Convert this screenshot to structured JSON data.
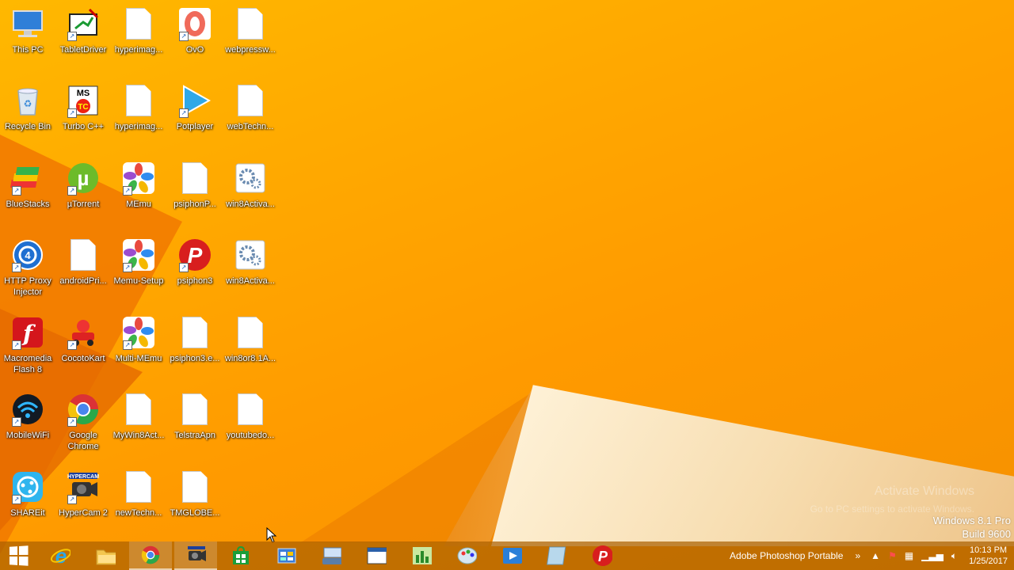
{
  "desktop_icons": [
    {
      "label": "This PC",
      "icon": "computer-icon",
      "col": 0,
      "row": 0
    },
    {
      "label": "Recycle Bin",
      "icon": "recycle-bin-icon",
      "col": 0,
      "row": 1
    },
    {
      "label": "BlueStacks",
      "icon": "bluestacks-icon",
      "col": 0,
      "row": 2
    },
    {
      "label": "HTTP Proxy Injector",
      "icon": "proxy-injector-icon",
      "col": 0,
      "row": 3
    },
    {
      "label": "Macromedia Flash 8",
      "icon": "flash-icon",
      "col": 0,
      "row": 4
    },
    {
      "label": "MobileWiFi",
      "icon": "wifi-icon",
      "col": 0,
      "row": 5
    },
    {
      "label": "SHAREit",
      "icon": "shareit-icon",
      "col": 0,
      "row": 6
    },
    {
      "label": "TabletDriver",
      "icon": "tablet-driver-icon",
      "col": 1,
      "row": 0
    },
    {
      "label": "Turbo C++",
      "icon": "turbo-cpp-icon",
      "col": 1,
      "row": 1
    },
    {
      "label": "µTorrent",
      "icon": "utorrent-icon",
      "col": 1,
      "row": 2
    },
    {
      "label": "androidPri...",
      "icon": "document-icon",
      "col": 1,
      "row": 3
    },
    {
      "label": "CocotoKart",
      "icon": "kart-icon",
      "col": 1,
      "row": 4
    },
    {
      "label": "Google Chrome",
      "icon": "chrome-icon",
      "col": 1,
      "row": 5
    },
    {
      "label": "HyperCam 2",
      "icon": "hypercam-icon",
      "col": 1,
      "row": 6
    },
    {
      "label": "hyperimag...",
      "icon": "document-icon",
      "col": 2,
      "row": 0
    },
    {
      "label": "hyperimag...",
      "icon": "document-icon",
      "col": 2,
      "row": 1
    },
    {
      "label": "MEmu",
      "icon": "memu-icon",
      "col": 2,
      "row": 2
    },
    {
      "label": "Memu-Setup",
      "icon": "memu-icon",
      "col": 2,
      "row": 3
    },
    {
      "label": "Multi-MEmu",
      "icon": "memu-icon",
      "col": 2,
      "row": 4
    },
    {
      "label": "MyWin8Act...",
      "icon": "document-icon",
      "col": 2,
      "row": 5
    },
    {
      "label": "newTechn...",
      "icon": "document-icon",
      "col": 2,
      "row": 6
    },
    {
      "label": "OvO",
      "icon": "ovo-icon",
      "col": 3,
      "row": 0
    },
    {
      "label": "Potplayer",
      "icon": "potplayer-icon",
      "col": 3,
      "row": 1
    },
    {
      "label": "psiphonP...",
      "icon": "document-icon",
      "col": 3,
      "row": 2
    },
    {
      "label": "psiphon3",
      "icon": "psiphon-icon",
      "col": 3,
      "row": 3
    },
    {
      "label": "psiphon3.e...",
      "icon": "document-icon",
      "col": 3,
      "row": 4
    },
    {
      "label": "TelstraApn",
      "icon": "document-icon",
      "col": 3,
      "row": 5
    },
    {
      "label": "TMGLOBE...",
      "icon": "document-icon",
      "col": 3,
      "row": 6
    },
    {
      "label": "webpressw...",
      "icon": "document-icon",
      "col": 4,
      "row": 0
    },
    {
      "label": "webTechn...",
      "icon": "document-icon",
      "col": 4,
      "row": 1
    },
    {
      "label": "win8Activa...",
      "icon": "settings-file-icon",
      "col": 4,
      "row": 2
    },
    {
      "label": "win8Activa...",
      "icon": "settings-file-icon",
      "col": 4,
      "row": 3
    },
    {
      "label": "win8or8.1A...",
      "icon": "document-icon",
      "col": 4,
      "row": 4
    },
    {
      "label": "youtubedo...",
      "icon": "document-icon",
      "col": 4,
      "row": 5
    }
  ],
  "watermark": {
    "title": "Activate Windows",
    "subtitle": "Go to PC settings to activate Windows."
  },
  "build_info": {
    "line1": "Windows 8.1 Pro",
    "line2": "Build 9600"
  },
  "taskbar": {
    "buttons": [
      {
        "name": "start-button",
        "icon": "windows-logo-icon"
      },
      {
        "name": "taskbar-internet-explorer",
        "icon": "internet-explorer-icon"
      },
      {
        "name": "taskbar-file-explorer",
        "icon": "folder-icon"
      },
      {
        "name": "taskbar-chrome",
        "icon": "chrome-icon"
      },
      {
        "name": "taskbar-hypercam",
        "icon": "hypercam-icon"
      },
      {
        "name": "taskbar-store",
        "icon": "store-icon"
      },
      {
        "name": "taskbar-control-panel",
        "icon": "control-panel-icon"
      },
      {
        "name": "taskbar-keyboard-app",
        "icon": "keyboard-icon"
      },
      {
        "name": "taskbar-window-app",
        "icon": "window-icon"
      },
      {
        "name": "taskbar-chart-app",
        "icon": "chart-icon"
      },
      {
        "name": "taskbar-paint-app",
        "icon": "paint-icon"
      },
      {
        "name": "taskbar-media-app",
        "icon": "media-icon"
      },
      {
        "name": "taskbar-blank-app",
        "icon": "app-icon"
      },
      {
        "name": "taskbar-psiphon",
        "icon": "psiphon-icon"
      }
    ],
    "toolbar_label": "Adobe Photoshop Portable",
    "toolbar_expand": "»",
    "clock": {
      "time": "10:13 PM",
      "date": "1/25/2017"
    }
  },
  "colors": {
    "accent": "#ffa600",
    "taskbar": "#aa5f00",
    "psiphon_red": "#d81e1e",
    "chrome_green": "#2aa84a"
  }
}
